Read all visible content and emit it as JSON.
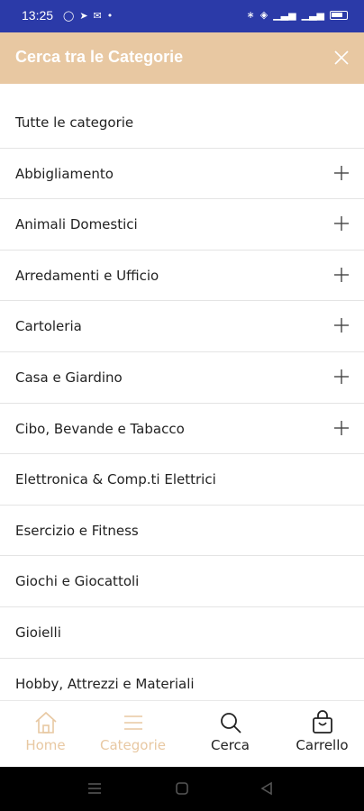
{
  "status_bar": {
    "time": "13:25"
  },
  "header": {
    "title": "Cerca tra le Categorie"
  },
  "categories": [
    {
      "label": "Tutte le categorie",
      "expandable": false
    },
    {
      "label": "Abbigliamento",
      "expandable": true
    },
    {
      "label": "Animali Domestici",
      "expandable": true
    },
    {
      "label": "Arredamenti e Ufficio",
      "expandable": true
    },
    {
      "label": "Cartoleria",
      "expandable": true
    },
    {
      "label": "Casa e Giardino",
      "expandable": true
    },
    {
      "label": "Cibo, Bevande e Tabacco",
      "expandable": true
    },
    {
      "label": "Elettronica & Comp.ti Elettrici",
      "expandable": false
    },
    {
      "label": "Esercizio e Fitness",
      "expandable": false
    },
    {
      "label": "Giochi e Giocattoli",
      "expandable": false
    },
    {
      "label": "Gioielli",
      "expandable": false
    },
    {
      "label": "Hobby, Attrezzi e Materiali",
      "expandable": false
    }
  ],
  "bottom_nav": [
    {
      "label": "Home",
      "icon": "home-icon",
      "state": "inactive"
    },
    {
      "label": "Categorie",
      "icon": "menu-icon",
      "state": "inactive"
    },
    {
      "label": "Cerca",
      "icon": "search-icon",
      "state": "active"
    },
    {
      "label": "Carrello",
      "icon": "cart-icon",
      "state": "active"
    }
  ],
  "colors": {
    "status_bar": "#2b3aa8",
    "header": "#e8c8a2",
    "accent": "#e8c8a2",
    "text": "#222222"
  }
}
